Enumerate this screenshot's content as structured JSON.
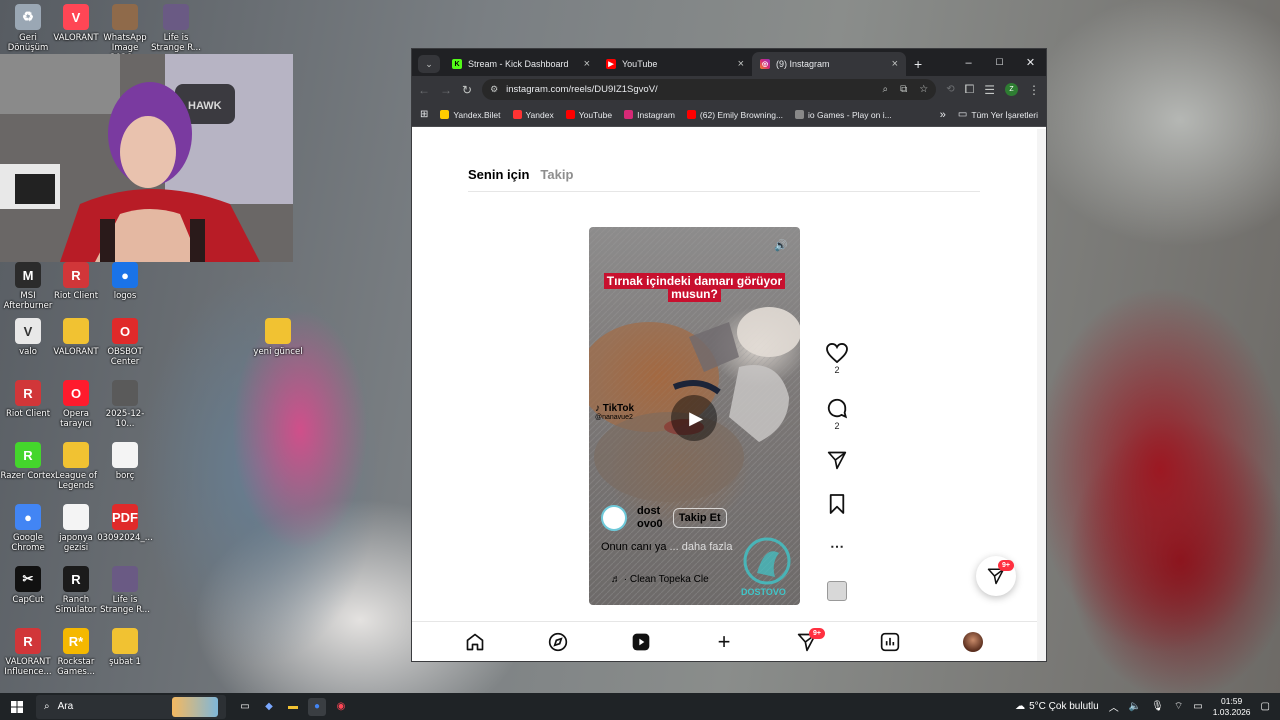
{
  "desktop": {
    "icons": [
      {
        "label": "Geri Dönüşüm",
        "color": "#9aa7b4",
        "glyph": "♻"
      },
      {
        "label": "VALORANT",
        "color": "#ff4655",
        "glyph": "V"
      },
      {
        "label": "WhatsApp Image 2026...",
        "color": "#8f6a4a",
        "glyph": ""
      },
      {
        "label": "Life is Strange R...",
        "color": "#6a5a84",
        "glyph": ""
      },
      {
        "label": "MSI Afterburner",
        "color": "#2b2b2b",
        "glyph": "M"
      },
      {
        "label": "Riot Client",
        "color": "#d13639",
        "glyph": "R"
      },
      {
        "label": "logos",
        "color": "#1a73e8",
        "glyph": "●"
      },
      {
        "label": "valo",
        "color": "#e8e8e8",
        "glyph": "V"
      },
      {
        "label": "VALORANT",
        "color": "#f1c232",
        "glyph": ""
      },
      {
        "label": "OBSBOT Center",
        "color": "#e02a2a",
        "glyph": "O"
      },
      {
        "label": "yeni güncel",
        "color": "#f1c232",
        "glyph": ""
      },
      {
        "label": "Riot Client",
        "color": "#d13639",
        "glyph": "R"
      },
      {
        "label": "Opera tarayıcı",
        "color": "#ff1b2d",
        "glyph": "O"
      },
      {
        "label": "2025-12-10...",
        "color": "#5a5a5a",
        "glyph": ""
      },
      {
        "label": "Razer Cortex",
        "color": "#44d62c",
        "glyph": "R"
      },
      {
        "label": "League of Legends",
        "color": "#f1c232",
        "glyph": ""
      },
      {
        "label": "borç",
        "color": "#f4f4f4",
        "glyph": ""
      },
      {
        "label": "Google Chrome",
        "color": "#4285f4",
        "glyph": "●"
      },
      {
        "label": "japonya gezisi",
        "color": "#f4f4f4",
        "glyph": ""
      },
      {
        "label": "03092024_...",
        "color": "#e02a2a",
        "glyph": "PDF"
      },
      {
        "label": "CapCut",
        "color": "#111111",
        "glyph": "✂"
      },
      {
        "label": "Ranch Simulator",
        "color": "#1b1b1b",
        "glyph": "R"
      },
      {
        "label": "Life is Strange R...",
        "color": "#6a5a84",
        "glyph": ""
      },
      {
        "label": "VALORANT Influence...",
        "color": "#d13639",
        "glyph": "R"
      },
      {
        "label": "Rockstar Games...",
        "color": "#f5b800",
        "glyph": "R*"
      },
      {
        "label": "şubat 1",
        "color": "#f1c232",
        "glyph": ""
      }
    ]
  },
  "browser": {
    "tabs": [
      {
        "title": "Stream - Kick Dashboard",
        "icon": "kick-icon",
        "color": "#53fc18"
      },
      {
        "title": "YouTube",
        "icon": "youtube-icon",
        "color": "#ff0000"
      },
      {
        "title": "(9) Instagram",
        "icon": "instagram-icon",
        "color": "#d62976"
      }
    ],
    "new_tab": "+",
    "window_controls": {
      "minimize": "–",
      "maximize": "☐",
      "close": "✕"
    },
    "url": "instagram.com/reels/DU9IZ1SgvoV/",
    "profile_initial": "Z",
    "bookmarks": [
      {
        "label": "Yandex.Bilet",
        "color": "#ffcc00"
      },
      {
        "label": "Yandex",
        "color": "#ff3333"
      },
      {
        "label": "YouTube",
        "color": "#ff0000"
      },
      {
        "label": "Instagram",
        "color": "#d62976"
      },
      {
        "label": "(62) Emily Browning...",
        "color": "#ff0000"
      },
      {
        "label": "io Games - Play on i...",
        "color": "#888888"
      }
    ],
    "bookmarks_overflow": "»",
    "all_bookmarks": "Tüm Yer İşaretleri"
  },
  "instagram": {
    "feed_tabs": [
      "Senin için",
      "Takip"
    ],
    "reel": {
      "caption_line1": "Tırnak içindeki damarı görüyor",
      "caption_line2": "musun?",
      "watermark": "TikTok",
      "watermark_handle": "@nanavue2",
      "username_line1": "dost",
      "username_line2": "ovo0",
      "follow_label": "Takip Et",
      "description": "Onun canı ya",
      "more_label": "... daha fazla",
      "audio_label": "· Clean  Topeka Cle",
      "logo_text": "DOSTOVO"
    },
    "actions": {
      "likes": "2",
      "comments": "2"
    },
    "messages_badge": "9+",
    "nav_badge": "9+"
  },
  "taskbar": {
    "search_placeholder": "Ara",
    "weather": "5°C  Çok bulutlu",
    "time": "01:59",
    "date": "1.03.2026"
  }
}
